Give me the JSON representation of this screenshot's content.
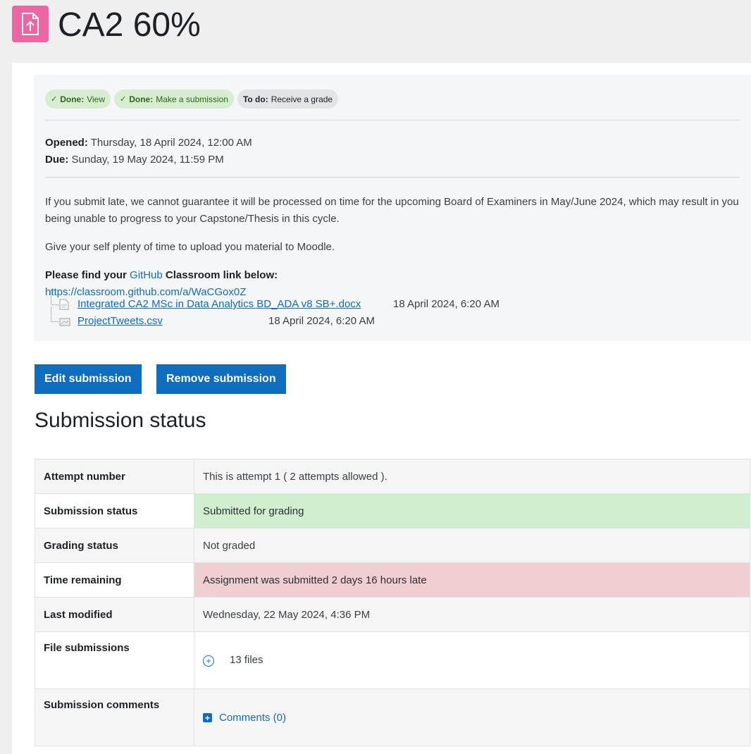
{
  "header": {
    "title": "CA2 60%",
    "icon": "assignment-upload-icon",
    "icon_color": "#eb66a2"
  },
  "completion": [
    {
      "state": "Done:",
      "label": "View"
    },
    {
      "state": "Done:",
      "label": "Make a submission"
    },
    {
      "state": "To do:",
      "label": "Receive a grade"
    }
  ],
  "dates": {
    "opened_label": "Opened:",
    "opened_value": "Thursday, 18 April 2024, 12:00 AM",
    "due_label": "Due:",
    "due_value": "Sunday, 19 May 2024, 11:59 PM"
  },
  "description": {
    "para1": "If you submit late, we cannot guarantee it will be processed on time for the upcoming Board of Examiners in May/June 2024, which may result in you being unable to progress to your Capstone/Thesis in this cycle.",
    "para2": "Give your self plenty of time to upload you material to Moodle.",
    "link_prefix": "Please find your ",
    "github": "GitHub",
    "link_suffix": " Classroom link below:",
    "url": "https://classroom.github.com/a/WaCGox0Z"
  },
  "files": [
    {
      "name": "Integrated CA2 MSc in Data Analytics BD_ADA v8 SB+.docx",
      "time": "18 April 2024, 6:20 AM",
      "icon": "document-file-icon"
    },
    {
      "name": "ProjectTweets.csv",
      "time": "18 April 2024, 6:20 AM",
      "icon": "spreadsheet-file-icon"
    }
  ],
  "actions": {
    "edit": "Edit submission",
    "remove": "Remove submission"
  },
  "submission_status": {
    "heading": "Submission status",
    "rows": {
      "attempt": {
        "label": "Attempt number",
        "value": "This is attempt 1 ( 2 attempts allowed )."
      },
      "status": {
        "label": "Submission status",
        "value": "Submitted for grading"
      },
      "grading": {
        "label": "Grading status",
        "value": "Not graded"
      },
      "time": {
        "label": "Time remaining",
        "value": "Assignment was submitted 2 days 16 hours late"
      },
      "modified": {
        "label": "Last modified",
        "value": "Wednesday, 22 May 2024, 4:36 PM"
      },
      "files": {
        "label": "File submissions",
        "value": "13 files"
      },
      "comments": {
        "label": "Submission comments",
        "value": "Comments (0)"
      }
    }
  },
  "colors": {
    "accent": "#0f6cbf",
    "success_bg": "#cfefcf",
    "danger_bg": "#efcfd2"
  }
}
